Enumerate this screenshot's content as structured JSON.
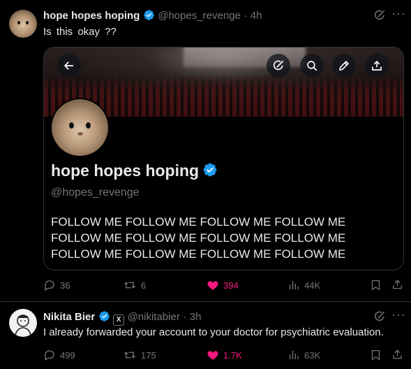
{
  "tweet1": {
    "author_name": "hope hopes hoping",
    "handle": "@hopes_revenge",
    "time": "4h",
    "text": "Is this okay ??",
    "card": {
      "profile_name": "hope hopes hoping",
      "profile_handle": "@hopes_revenge",
      "bio_lines": [
        "FOLLOW ME FOLLOW ME FOLLOW ME FOLLOW ME",
        "FOLLOW ME FOLLOW ME FOLLOW ME FOLLOW ME",
        "FOLLOW ME FOLLOW ME FOLLOW ME FOLLOW ME"
      ]
    },
    "stats": {
      "replies": "36",
      "reposts": "6",
      "likes": "394",
      "views": "44K"
    }
  },
  "tweet2": {
    "author_name": "Nikita Bier",
    "handle": "@nikitabier",
    "time": "3h",
    "text": "I already forwarded your account to your doctor for psychiatric evaluation.",
    "stats": {
      "replies": "499",
      "reposts": "175",
      "likes": "1.7K",
      "views": "63K"
    }
  },
  "colors": {
    "background": "#000000",
    "text": "#e7e9ea",
    "muted": "#71767b",
    "like": "#f91880",
    "verified": "#1d9bf0"
  },
  "icons": [
    "grok-icon",
    "more-icon",
    "back-arrow-icon",
    "search-icon",
    "edit-pencil-icon",
    "share-icon",
    "reply-icon",
    "repost-icon",
    "like-heart-icon",
    "views-icon",
    "bookmark-icon",
    "x-logo-icon",
    "verified-badge-icon"
  ]
}
